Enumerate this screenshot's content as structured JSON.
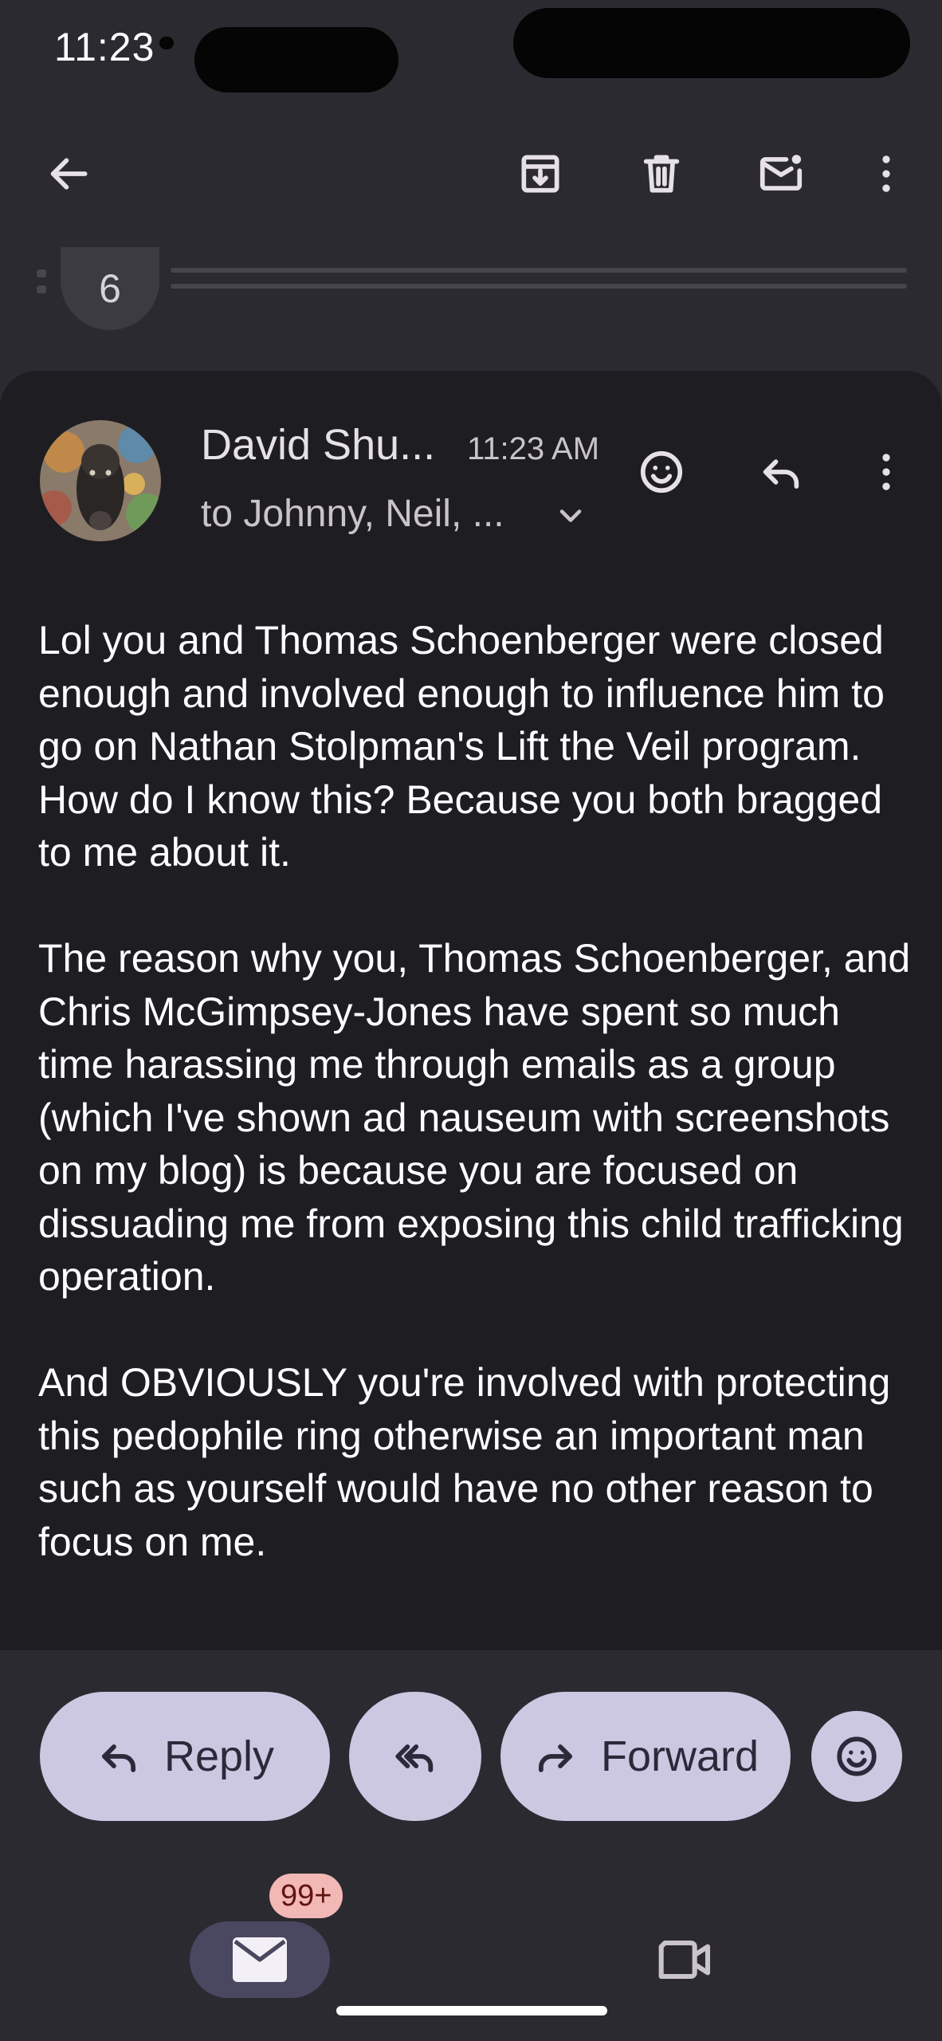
{
  "status_bar": {
    "time": "11:23"
  },
  "app_bar": {
    "icons": [
      "back-arrow-icon",
      "archive-icon",
      "delete-icon",
      "mark-unread-icon",
      "more-vert-icon"
    ]
  },
  "thread": {
    "collapsed_count": "6"
  },
  "message": {
    "sender": "David Shu...",
    "time": "11:23 AM",
    "recipients": "to Johnny, Neil, ...",
    "body": [
      "Lol you and Thomas Schoenberger were closed enough and involved enough to influence him to go on Nathan Stolpman's Lift the Veil program. How do I know this? Because you both bragged to me about it.",
      "The reason why you, Thomas Schoenberger, and Chris McGimpsey-Jones have spent so much time harassing me through emails as a group (which I've shown ad nauseum with screenshots on my blog) is because you are focused on dissuading me from exposing this child trafficking operation.",
      "And OBVIOUSLY you're involved with protecting this pedophile ring otherwise an important man such as yourself would have no other reason to focus on me."
    ]
  },
  "actions": {
    "reply": "Reply",
    "forward": "Forward"
  },
  "bottom_nav": {
    "mail_badge": "99+"
  },
  "colors": {
    "background": "#2b2a30",
    "card": "#1e1d22",
    "pill": "#cdc8e2",
    "badge": "#f2b8b5"
  }
}
